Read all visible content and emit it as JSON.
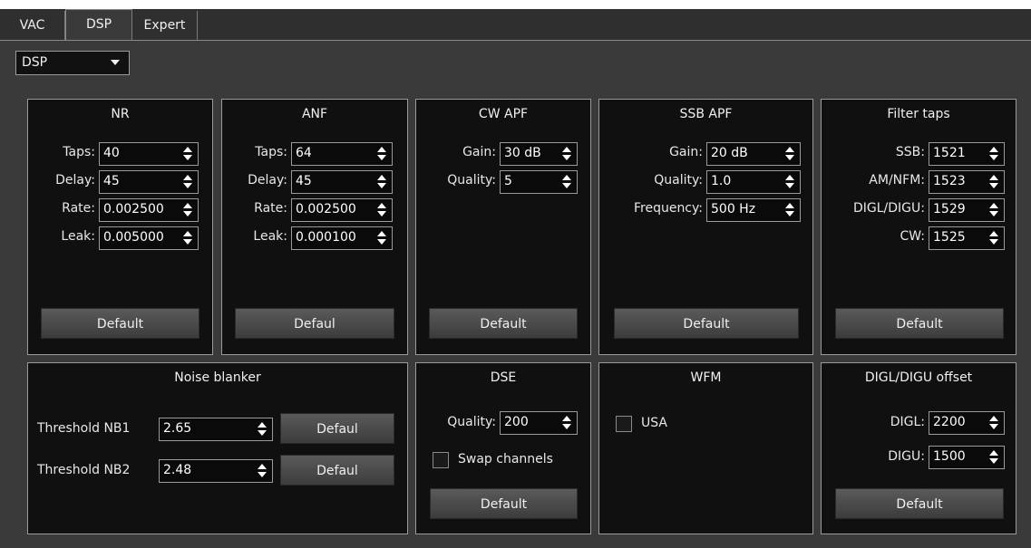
{
  "tabs": [
    {
      "label": "VAC"
    },
    {
      "label": "DSP"
    },
    {
      "label": "Expert"
    }
  ],
  "mode_combo": {
    "value": "DSP"
  },
  "nr": {
    "title": "NR",
    "taps_label": "Taps:",
    "taps": "40",
    "delay_label": "Delay:",
    "delay": "45",
    "rate_label": "Rate:",
    "rate": "0.002500",
    "leak_label": "Leak:",
    "leak": "0.005000",
    "default": "Default"
  },
  "anf": {
    "title": "ANF",
    "taps_label": "Taps:",
    "taps": "64",
    "delay_label": "Delay:",
    "delay": "45",
    "rate_label": "Rate:",
    "rate": "0.002500",
    "leak_label": "Leak:",
    "leak": "0.000100",
    "default": "Defaul"
  },
  "cw_apf": {
    "title": "CW APF",
    "gain_label": "Gain:",
    "gain": "30 dB",
    "quality_label": "Quality:",
    "quality": "5",
    "default": "Default"
  },
  "ssb_apf": {
    "title": "SSB APF",
    "gain_label": "Gain:",
    "gain": "20 dB",
    "quality_label": "Quality:",
    "quality": "1.0",
    "freq_label": "Frequency:",
    "freq": "500 Hz",
    "default": "Default"
  },
  "filter_taps": {
    "title": "Filter taps",
    "ssb_label": "SSB:",
    "ssb": "1521",
    "am_label": "AM/NFM:",
    "am": "1523",
    "digl_label": "DIGL/DIGU:",
    "digl": "1529",
    "cw_label": "CW:",
    "cw": "1525",
    "default": "Default"
  },
  "noise_blanker": {
    "title": "Noise blanker",
    "nb1_label": "Threshold NB1",
    "nb1": "2.65",
    "nb1_default": "Defaul",
    "nb2_label": "Threshold NB2",
    "nb2": "2.48",
    "nb2_default": "Defaul"
  },
  "dse": {
    "title": "DSE",
    "quality_label": "Quality:",
    "quality": "200",
    "swap_label": "Swap channels",
    "default": "Default"
  },
  "wfm": {
    "title": "WFM",
    "usa_label": "USA"
  },
  "digl_offset": {
    "title": "DIGL/DIGU offset",
    "digl_label": "DIGL:",
    "digl": "2200",
    "digu_label": "DIGU:",
    "digu": "1500",
    "default": "Default"
  }
}
